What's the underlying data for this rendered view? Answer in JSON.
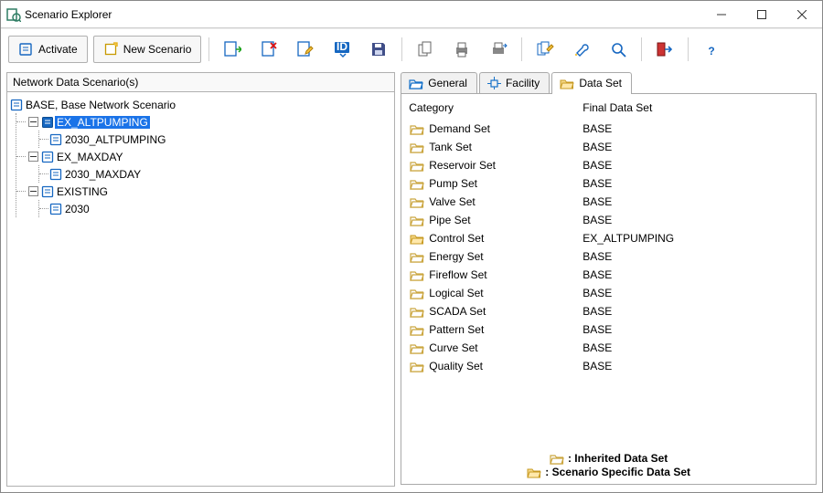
{
  "window": {
    "title": "Scenario Explorer"
  },
  "toolbar": {
    "activate_label": "Activate",
    "new_scenario_label": "New Scenario"
  },
  "left": {
    "header": "Network Data Scenario(s)",
    "nodes": {
      "base": "BASE, Base Network Scenario",
      "ex_altpumping": "EX_ALTPUMPING",
      "ex_altpumping_child": "2030_ALTPUMPING",
      "ex_maxday": "EX_MAXDAY",
      "ex_maxday_child": "2030_MAXDAY",
      "existing": "EXISTING",
      "existing_child": "2030"
    }
  },
  "tabs": {
    "general": "General",
    "facility": "Facility",
    "dataset": "Data Set"
  },
  "dataset_table": {
    "header_category": "Category",
    "header_final": "Final Data Set",
    "rows": [
      {
        "category": "Demand Set",
        "value": "BASE",
        "specific": false
      },
      {
        "category": "Tank Set",
        "value": "BASE",
        "specific": false
      },
      {
        "category": "Reservoir Set",
        "value": "BASE",
        "specific": false
      },
      {
        "category": "Pump Set",
        "value": "BASE",
        "specific": false
      },
      {
        "category": "Valve Set",
        "value": "BASE",
        "specific": false
      },
      {
        "category": "Pipe Set",
        "value": "BASE",
        "specific": false
      },
      {
        "category": "Control Set",
        "value": "EX_ALTPUMPING",
        "specific": true
      },
      {
        "category": "Energy Set",
        "value": "BASE",
        "specific": false
      },
      {
        "category": "Fireflow Set",
        "value": "BASE",
        "specific": false
      },
      {
        "category": "Logical Set",
        "value": "BASE",
        "specific": false
      },
      {
        "category": "SCADA Set",
        "value": "BASE",
        "specific": false
      },
      {
        "category": "Pattern Set",
        "value": "BASE",
        "specific": false
      },
      {
        "category": "Curve Set",
        "value": "BASE",
        "specific": false
      },
      {
        "category": "Quality Set",
        "value": "BASE",
        "specific": false
      }
    ]
  },
  "legend": {
    "inherited": ": Inherited Data Set",
    "specific": ": Scenario Specific Data Set"
  }
}
